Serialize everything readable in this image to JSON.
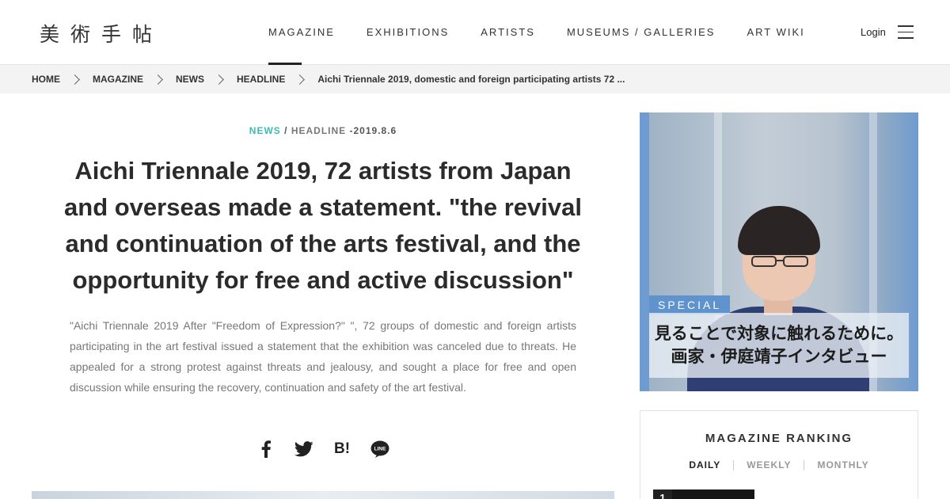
{
  "site": {
    "logo_text": "美術手帖"
  },
  "nav": {
    "items": [
      "MAGAZINE",
      "EXHIBITIONS",
      "ARTISTS",
      "MUSEUMS / GALLERIES",
      "ART WIKI"
    ],
    "active": "MAGAZINE",
    "login_label": "Login"
  },
  "breadcrumb": {
    "items": [
      "HOME",
      "MAGAZINE",
      "NEWS",
      "HEADLINE"
    ],
    "current": "Aichi Triennale 2019, domestic and foreign participating artists 72 ..."
  },
  "article": {
    "category": "NEWS",
    "separator": "/",
    "subcategory": "HEADLINE",
    "date": "-2019.8.6",
    "title": "Aichi Triennale 2019, 72 artists from Japan and overseas made a statement. \"the revival and continuation of the arts festival, and the opportunity for free and active discussion\"",
    "lead": "\"Aichi Triennale 2019 After \"Freedom of Expression?\" \", 72 groups of domestic and foreign artists participating in the art festival issued a statement that the exhibition was canceled due to threats. He appealed for a strong protest against threats and jealousy, and sought a place for free and open discussion while ensuring the recovery, continuation and safety of the art festival."
  },
  "share": {
    "icons": [
      "facebook-icon",
      "twitter-icon",
      "hatena-bookmark-icon",
      "line-icon"
    ],
    "hatena_text": "B!",
    "line_text": "LINE"
  },
  "promo": {
    "tag": "SPECIAL",
    "caption_line1": "見ることで対象に触れるために。",
    "caption_line2": "画家・伊庭靖子インタビュー"
  },
  "ranking": {
    "title": "MAGAZINE RANKING",
    "tabs": [
      "DAILY",
      "WEEKLY",
      "MONTHLY"
    ],
    "active_tab": "DAILY",
    "first_rank": "1"
  },
  "colors": {
    "accent": "#3bbdb5",
    "promo_blue": "#5f93cd",
    "breadcrumb_bg": "#f3f3f3"
  }
}
